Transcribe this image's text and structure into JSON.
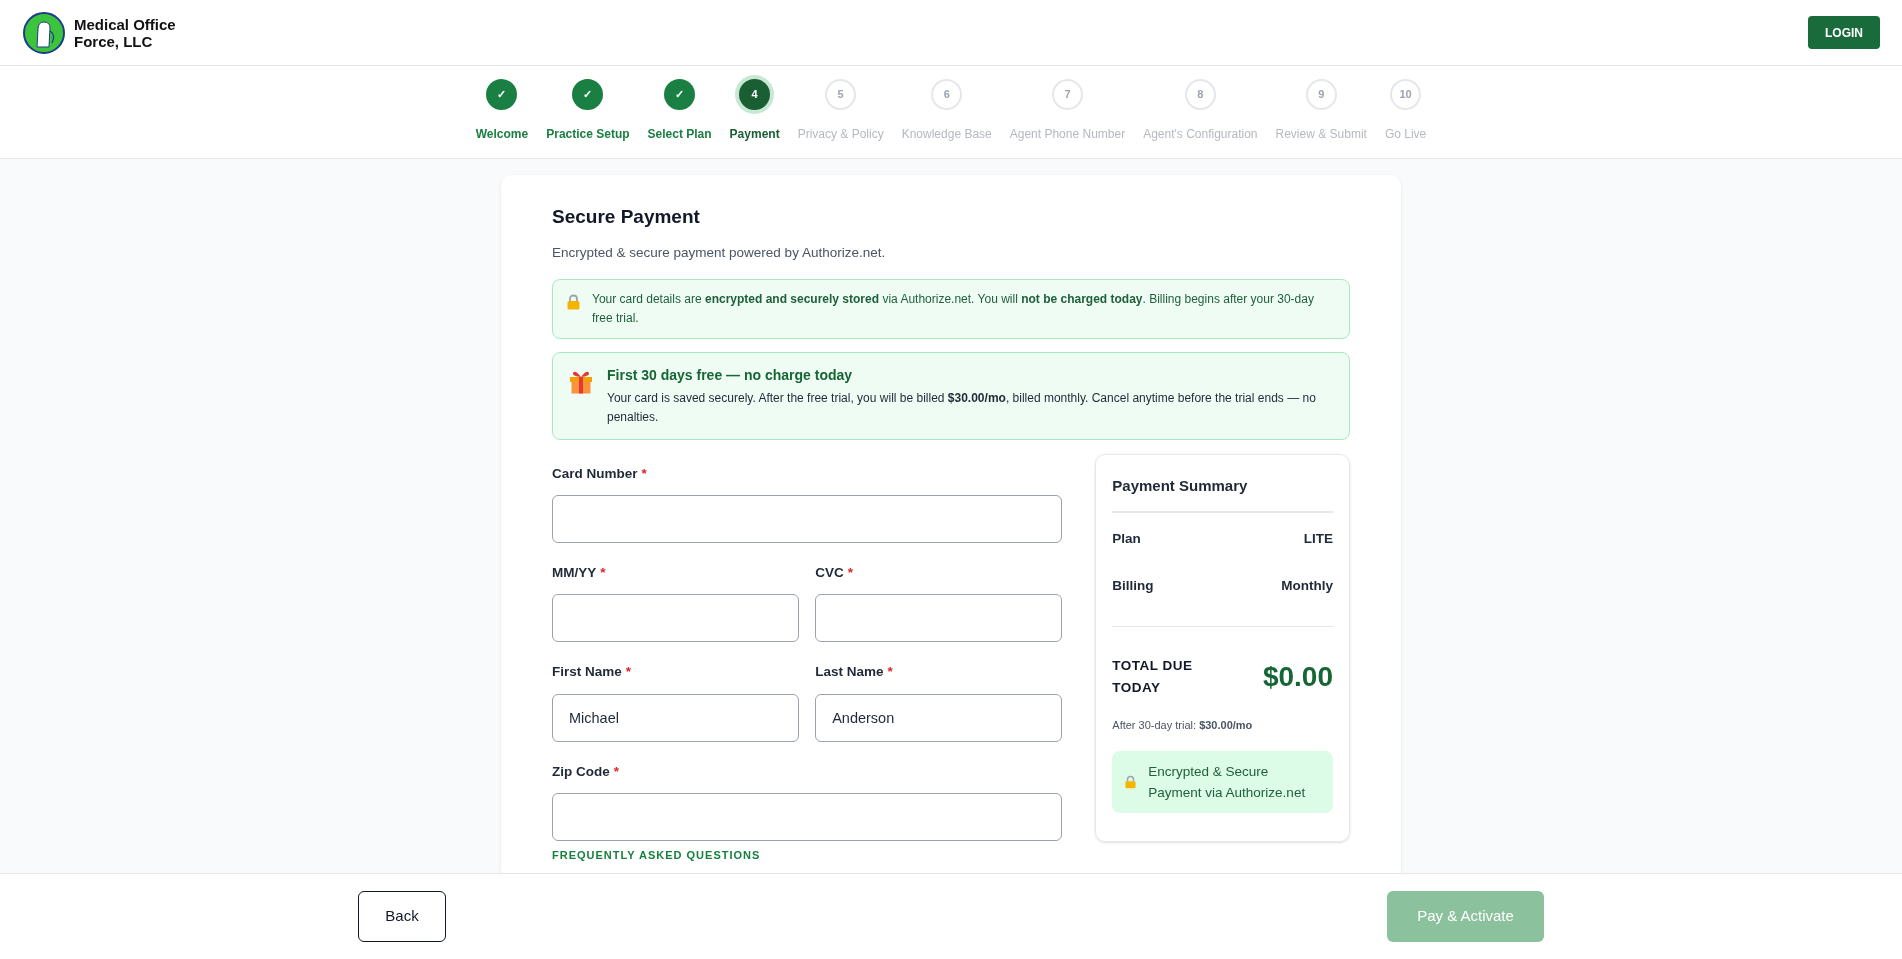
{
  "header": {
    "brand": "Medical Office\nForce, LLC",
    "login_button": "LOGIN"
  },
  "steps": [
    {
      "marker": "✓",
      "label": "Welcome",
      "completed": true,
      "selected": false
    },
    {
      "marker": "✓",
      "label": "Practice Setup",
      "completed": true,
      "selected": false
    },
    {
      "marker": "✓",
      "label": "Select Plan",
      "completed": true,
      "selected": false
    },
    {
      "marker": "4",
      "label": "Payment",
      "completed": false,
      "selected": true
    },
    {
      "marker": "5",
      "label": "Privacy & Policy",
      "completed": false,
      "selected": false
    },
    {
      "marker": "6",
      "label": "Knowledge Base",
      "completed": false,
      "selected": false
    },
    {
      "marker": "7",
      "label": "Agent Phone Number",
      "completed": false,
      "selected": false
    },
    {
      "marker": "8",
      "label": "Agent's Configuration",
      "completed": false,
      "selected": false
    },
    {
      "marker": "9",
      "label": "Review & Submit",
      "completed": false,
      "selected": false
    },
    {
      "marker": "10",
      "label": "Go Live",
      "completed": false,
      "selected": false
    }
  ],
  "title": "Secure Payment",
  "subtitle": "Encrypted & secure payment powered by Authorize.net.",
  "notice": "Your card details are **encrypted and securely stored** via Authorize.net. You will **not be charged today**. Billing begins after your 30-day free trial.",
  "trial": {
    "title": "First 30 days free — no charge today",
    "text": "Your card is saved securely. After the free trial, you will be billed **$30.00/mo**, billed monthly. Cancel anytime before the trial ends — no penalties."
  },
  "field_rows": [
    [
      {
        "label": "Card Number",
        "required_mark": "*"
      }
    ],
    [
      {
        "label": "MM/YY",
        "required_mark": "*"
      },
      {
        "label": "CVC",
        "required_mark": "*"
      }
    ],
    [
      {
        "label": "First Name",
        "required_mark": "*",
        "value": "Michael"
      },
      {
        "label": "Last Name",
        "required_mark": "*",
        "value": "Anderson"
      }
    ],
    [
      {
        "label": "Zip Code",
        "required_mark": "*"
      }
    ]
  ],
  "faq_heading": "FREQUENTLY ASKED QUESTIONS",
  "summary": {
    "title": "Payment Summary",
    "rows": [
      {
        "label": "Plan",
        "value": "LITE"
      },
      {
        "label": "Billing",
        "value": "Monthly"
      }
    ],
    "total_label": "TOTAL DUE TODAY",
    "total": "$0.00",
    "after": "After 30-day trial: **$30.00/mo**",
    "secure": "Encrypted & Secure Payment via Authorize.net"
  },
  "footer": {
    "back": "Back",
    "pay": {
      "label": "Pay & Activate",
      "disabled": true
    }
  }
}
